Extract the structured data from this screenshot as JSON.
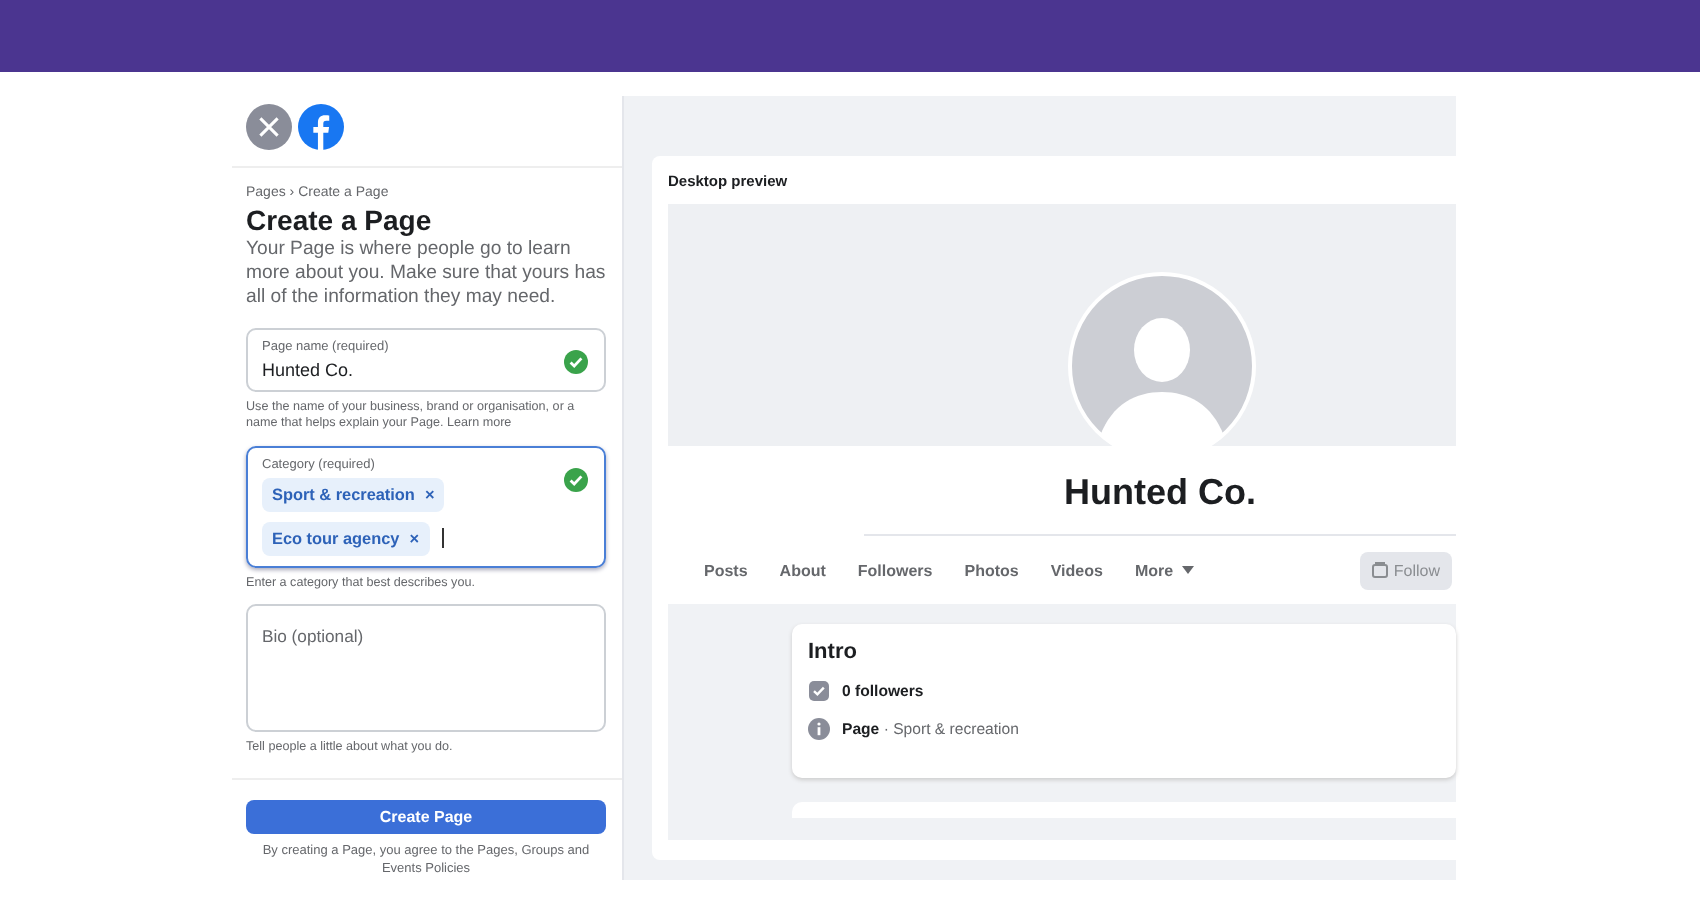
{
  "form": {
    "breadcrumb": "Pages › Create a Page",
    "title": "Create a Page",
    "description": "Your Page is where people go to learn more about you. Make sure that yours has all of the information they may need.",
    "page_name": {
      "label": "Page name (required)",
      "value": "Hunted Co.",
      "valid": true,
      "focused": false,
      "helper": "Use the name of your business, brand or organisation, or a name that helps explain your Page.",
      "helper_link": "Learn more"
    },
    "category": {
      "label": "Category (required)",
      "valid": true,
      "focused": true,
      "tags": [
        {
          "label": "Sport & recreation",
          "remove": "×"
        },
        {
          "label": "Eco tour agency",
          "remove": "×"
        }
      ],
      "helper": "Enter a category that best describes you."
    },
    "bio": {
      "placeholder": "Bio (optional)",
      "focused": false,
      "helper": "Tell people a little about what you do."
    },
    "submit": "Create Page",
    "terms": "By creating a Page, you agree to the Pages, Groups and Events Policies"
  },
  "preview": {
    "title": "Desktop preview",
    "page_name": "Hunted Co.",
    "tabs": [
      {
        "label": "Posts",
        "kind": "link"
      },
      {
        "label": "About",
        "kind": "link"
      },
      {
        "label": "Followers",
        "kind": "link"
      },
      {
        "label": "Photos",
        "kind": "link"
      },
      {
        "label": "Videos",
        "kind": "link"
      },
      {
        "label": "More",
        "kind": "dropdown"
      }
    ],
    "follow": {
      "label": "Follow",
      "disabled": true
    },
    "intro": {
      "title": "Intro",
      "followers": "0 followers",
      "type": "Page",
      "separator": "·",
      "category": "Sport & recreation"
    }
  }
}
